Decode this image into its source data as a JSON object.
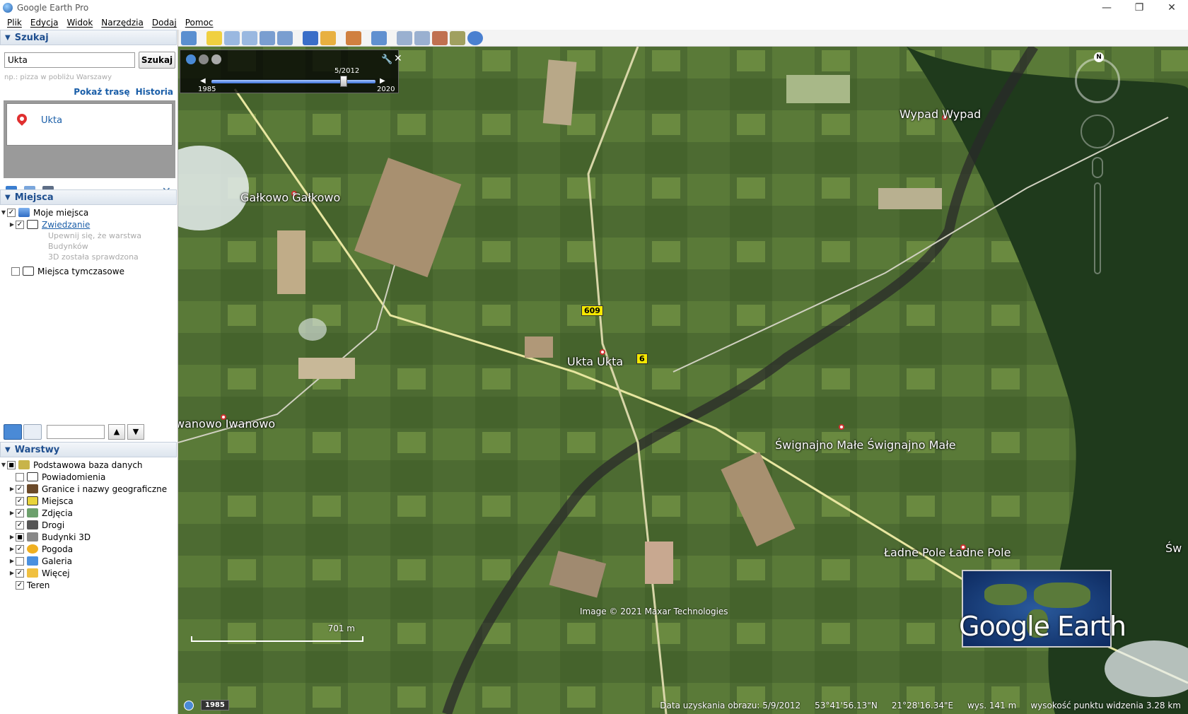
{
  "window": {
    "title": "Google Earth Pro",
    "controls": [
      "—",
      "❐",
      "✕"
    ]
  },
  "menu": [
    "Plik",
    "Edycja",
    "Widok",
    "Narzędzia",
    "Dodaj",
    "Pomoc"
  ],
  "search": {
    "header": "Szukaj",
    "value": "Ukta",
    "button": "Szukaj",
    "hint": "np.: pizza w pobliżu Warszawy",
    "route_link": "Pokaż trasę",
    "history_link": "Historia",
    "result": "Ukta"
  },
  "places": {
    "header": "Miejsca",
    "my_places": "Moje miejsca",
    "sightseeing": "Zwiedzanie",
    "sightseeing_note_1": "Upewnij się, że warstwa Budynków",
    "sightseeing_note_2": "3D została sprawdzona",
    "temporary": "Miejsca tymczasowe"
  },
  "layers": {
    "header": "Warstwy",
    "items": [
      {
        "label": "Podstawowa baza danych",
        "checked": "■"
      },
      {
        "label": "Powiadomienia",
        "checked": ""
      },
      {
        "label": "Granice i nazwy geograficzne",
        "checked": "✓"
      },
      {
        "label": "Miejsca",
        "checked": "✓"
      },
      {
        "label": "Zdjęcia",
        "checked": "✓"
      },
      {
        "label": "Drogi",
        "checked": "✓"
      },
      {
        "label": "Budynki 3D",
        "checked": "■"
      },
      {
        "label": "Pogoda",
        "checked": "✓"
      },
      {
        "label": "Galeria",
        "checked": ""
      },
      {
        "label": "Więcej",
        "checked": "✓"
      },
      {
        "label": "Teren",
        "checked": "✓"
      }
    ]
  },
  "map": {
    "labels": {
      "galkowo": "Gałkowo  Gałkowo",
      "wypad": "Wypad  Wypad",
      "ukta": "Ukta  Ukta",
      "iwanowo": "wanowo  Iwanowo",
      "swignajno": "Śwignajno Małe  Śwignajno Małe",
      "ladne": "Ładne Pole  Ładne Pole",
      "sw": "Św"
    },
    "road_609": "609",
    "road_6x": "6",
    "time_slider": {
      "date": "5/2012",
      "start": "1985",
      "end": "2020"
    },
    "credit": "Image © 2021 Maxar Technologies",
    "logo": "Google Earth",
    "scale": "701 m",
    "status": {
      "year_badge": "1985",
      "date": "Data uzyskania obrazu: 5/9/2012",
      "lat": "53°41'56.13\"N",
      "lon": "21°28'16.34\"E",
      "elev": "wys.  141 m",
      "eye": "wysokość punktu widzenia   3.28 km"
    },
    "compass_n": "N"
  }
}
